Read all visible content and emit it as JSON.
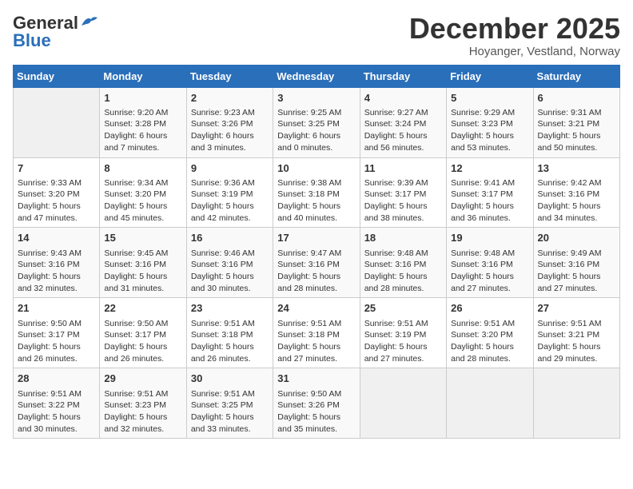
{
  "logo": {
    "line1": "General",
    "line2": "Blue"
  },
  "title": "December 2025",
  "subtitle": "Hoyanger, Vestland, Norway",
  "header_days": [
    "Sunday",
    "Monday",
    "Tuesday",
    "Wednesday",
    "Thursday",
    "Friday",
    "Saturday"
  ],
  "weeks": [
    [
      {
        "day": "",
        "info": ""
      },
      {
        "day": "1",
        "info": "Sunrise: 9:20 AM\nSunset: 3:28 PM\nDaylight: 6 hours\nand 7 minutes."
      },
      {
        "day": "2",
        "info": "Sunrise: 9:23 AM\nSunset: 3:26 PM\nDaylight: 6 hours\nand 3 minutes."
      },
      {
        "day": "3",
        "info": "Sunrise: 9:25 AM\nSunset: 3:25 PM\nDaylight: 6 hours\nand 0 minutes."
      },
      {
        "day": "4",
        "info": "Sunrise: 9:27 AM\nSunset: 3:24 PM\nDaylight: 5 hours\nand 56 minutes."
      },
      {
        "day": "5",
        "info": "Sunrise: 9:29 AM\nSunset: 3:23 PM\nDaylight: 5 hours\nand 53 minutes."
      },
      {
        "day": "6",
        "info": "Sunrise: 9:31 AM\nSunset: 3:21 PM\nDaylight: 5 hours\nand 50 minutes."
      }
    ],
    [
      {
        "day": "7",
        "info": "Sunrise: 9:33 AM\nSunset: 3:20 PM\nDaylight: 5 hours\nand 47 minutes."
      },
      {
        "day": "8",
        "info": "Sunrise: 9:34 AM\nSunset: 3:20 PM\nDaylight: 5 hours\nand 45 minutes."
      },
      {
        "day": "9",
        "info": "Sunrise: 9:36 AM\nSunset: 3:19 PM\nDaylight: 5 hours\nand 42 minutes."
      },
      {
        "day": "10",
        "info": "Sunrise: 9:38 AM\nSunset: 3:18 PM\nDaylight: 5 hours\nand 40 minutes."
      },
      {
        "day": "11",
        "info": "Sunrise: 9:39 AM\nSunset: 3:17 PM\nDaylight: 5 hours\nand 38 minutes."
      },
      {
        "day": "12",
        "info": "Sunrise: 9:41 AM\nSunset: 3:17 PM\nDaylight: 5 hours\nand 36 minutes."
      },
      {
        "day": "13",
        "info": "Sunrise: 9:42 AM\nSunset: 3:16 PM\nDaylight: 5 hours\nand 34 minutes."
      }
    ],
    [
      {
        "day": "14",
        "info": "Sunrise: 9:43 AM\nSunset: 3:16 PM\nDaylight: 5 hours\nand 32 minutes."
      },
      {
        "day": "15",
        "info": "Sunrise: 9:45 AM\nSunset: 3:16 PM\nDaylight: 5 hours\nand 31 minutes."
      },
      {
        "day": "16",
        "info": "Sunrise: 9:46 AM\nSunset: 3:16 PM\nDaylight: 5 hours\nand 30 minutes."
      },
      {
        "day": "17",
        "info": "Sunrise: 9:47 AM\nSunset: 3:16 PM\nDaylight: 5 hours\nand 28 minutes."
      },
      {
        "day": "18",
        "info": "Sunrise: 9:48 AM\nSunset: 3:16 PM\nDaylight: 5 hours\nand 28 minutes."
      },
      {
        "day": "19",
        "info": "Sunrise: 9:48 AM\nSunset: 3:16 PM\nDaylight: 5 hours\nand 27 minutes."
      },
      {
        "day": "20",
        "info": "Sunrise: 9:49 AM\nSunset: 3:16 PM\nDaylight: 5 hours\nand 27 minutes."
      }
    ],
    [
      {
        "day": "21",
        "info": "Sunrise: 9:50 AM\nSunset: 3:17 PM\nDaylight: 5 hours\nand 26 minutes."
      },
      {
        "day": "22",
        "info": "Sunrise: 9:50 AM\nSunset: 3:17 PM\nDaylight: 5 hours\nand 26 minutes."
      },
      {
        "day": "23",
        "info": "Sunrise: 9:51 AM\nSunset: 3:18 PM\nDaylight: 5 hours\nand 26 minutes."
      },
      {
        "day": "24",
        "info": "Sunrise: 9:51 AM\nSunset: 3:18 PM\nDaylight: 5 hours\nand 27 minutes."
      },
      {
        "day": "25",
        "info": "Sunrise: 9:51 AM\nSunset: 3:19 PM\nDaylight: 5 hours\nand 27 minutes."
      },
      {
        "day": "26",
        "info": "Sunrise: 9:51 AM\nSunset: 3:20 PM\nDaylight: 5 hours\nand 28 minutes."
      },
      {
        "day": "27",
        "info": "Sunrise: 9:51 AM\nSunset: 3:21 PM\nDaylight: 5 hours\nand 29 minutes."
      }
    ],
    [
      {
        "day": "28",
        "info": "Sunrise: 9:51 AM\nSunset: 3:22 PM\nDaylight: 5 hours\nand 30 minutes."
      },
      {
        "day": "29",
        "info": "Sunrise: 9:51 AM\nSunset: 3:23 PM\nDaylight: 5 hours\nand 32 minutes."
      },
      {
        "day": "30",
        "info": "Sunrise: 9:51 AM\nSunset: 3:25 PM\nDaylight: 5 hours\nand 33 minutes."
      },
      {
        "day": "31",
        "info": "Sunrise: 9:50 AM\nSunset: 3:26 PM\nDaylight: 5 hours\nand 35 minutes."
      },
      {
        "day": "",
        "info": ""
      },
      {
        "day": "",
        "info": ""
      },
      {
        "day": "",
        "info": ""
      }
    ]
  ]
}
